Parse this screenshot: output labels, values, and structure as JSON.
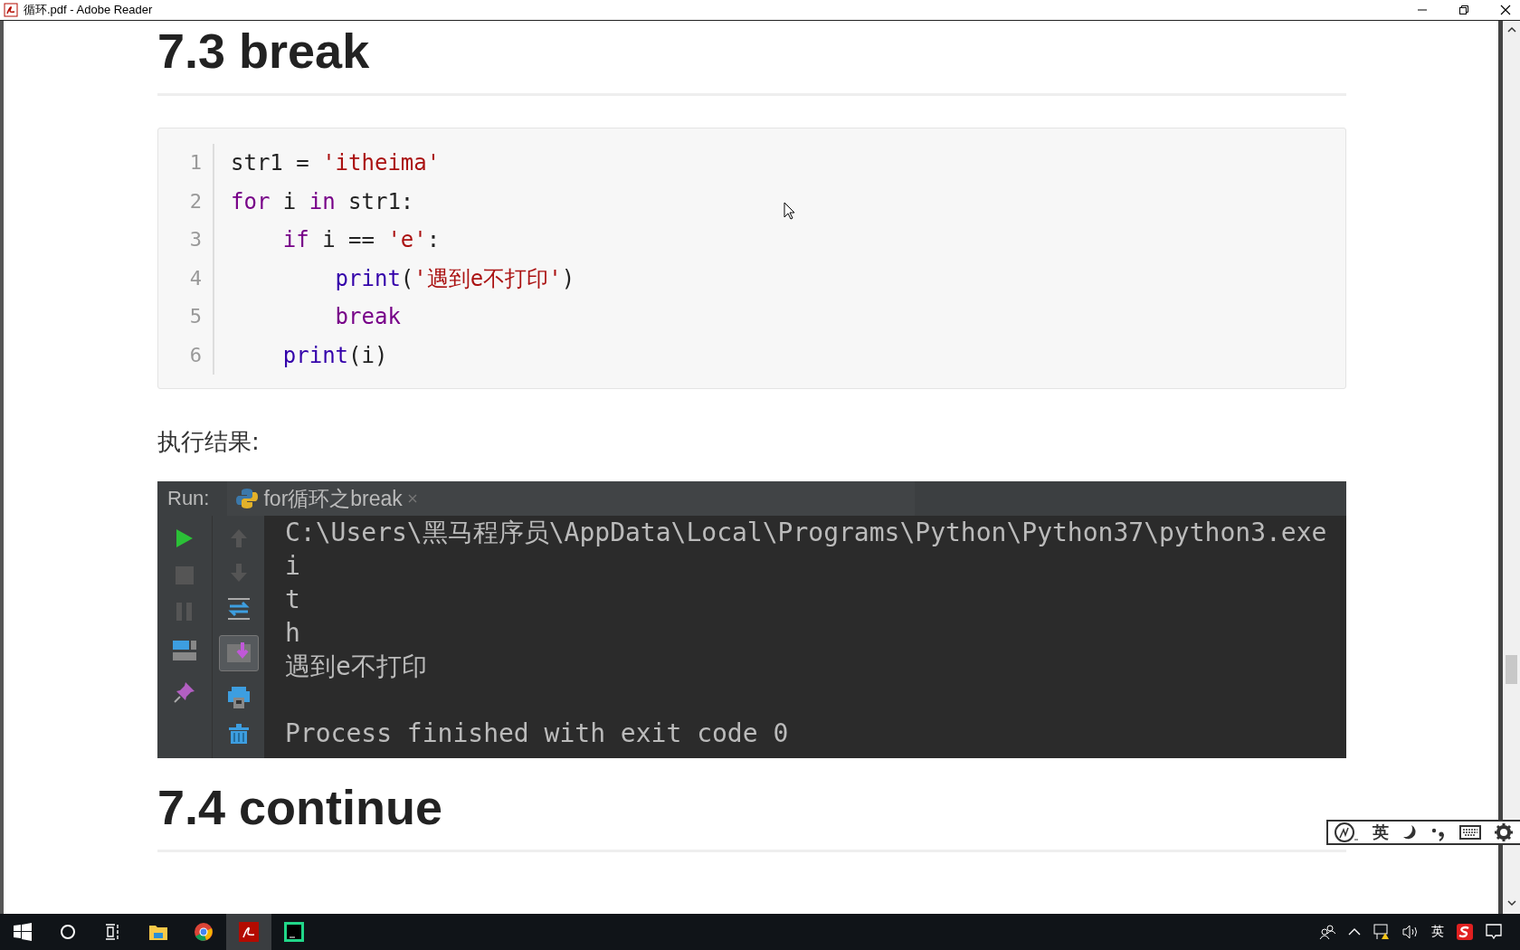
{
  "window": {
    "title": "循环.pdf - Adobe Reader"
  },
  "document": {
    "heading": "7.3 break",
    "code": [
      {
        "number": "1",
        "tokens": [
          {
            "kind": "plain",
            "text": "str1 = "
          },
          {
            "kind": "string",
            "text": "'itheima'"
          }
        ]
      },
      {
        "number": "2",
        "tokens": [
          {
            "kind": "keyword",
            "text": "for"
          },
          {
            "kind": "plain",
            "text": " i "
          },
          {
            "kind": "keyword",
            "text": "in"
          },
          {
            "kind": "plain",
            "text": " str1:"
          }
        ]
      },
      {
        "number": "3",
        "tokens": [
          {
            "kind": "keyword",
            "text": "    if"
          },
          {
            "kind": "plain",
            "text": " i == "
          },
          {
            "kind": "string",
            "text": "'e'"
          },
          {
            "kind": "plain",
            "text": ":"
          }
        ]
      },
      {
        "number": "4",
        "tokens": [
          {
            "kind": "builtin",
            "text": "        print"
          },
          {
            "kind": "plain",
            "text": "("
          },
          {
            "kind": "string",
            "text": "'遇到e不打印'"
          },
          {
            "kind": "plain",
            "text": ")"
          }
        ]
      },
      {
        "number": "5",
        "tokens": [
          {
            "kind": "keyword",
            "text": "        break"
          }
        ]
      },
      {
        "number": "6",
        "tokens": [
          {
            "kind": "builtin",
            "text": "    print"
          },
          {
            "kind": "plain",
            "text": "(i)"
          }
        ]
      }
    ],
    "result_label": "执行结果:",
    "run_panel": {
      "label": "Run:",
      "tab": "for循环之break",
      "autoscroll": true,
      "output": [
        "C:\\Users\\黑马程序员\\AppData\\Local\\Programs\\Python\\Python37\\python3.exe",
        "i",
        "t",
        "h",
        "遇到e不打印"
      ],
      "exit_message": "Process finished with exit code 0"
    },
    "next_heading": "7.4 continue"
  },
  "ime_bar": {
    "mode": "英"
  },
  "tray": {
    "ime": "英"
  }
}
